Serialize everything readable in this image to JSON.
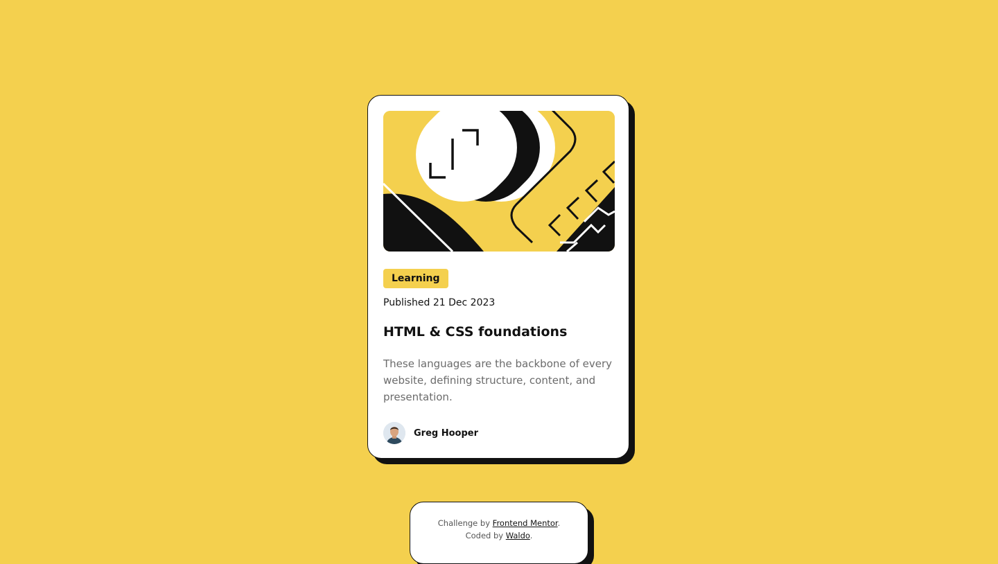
{
  "card": {
    "tag": "Learning",
    "published": "Published 21 Dec 2023",
    "title": "HTML & CSS foundations",
    "description": "These languages are the backbone of every website, defining structure, content, and presentation.",
    "author": "Greg Hooper",
    "hero_icon": "code-illustration"
  },
  "attribution": {
    "challenge_prefix": "Challenge by",
    "challenge_link": "Frontend Mentor",
    "coded_prefix": "Coded by",
    "coded_link": "Waldo",
    "period": "."
  },
  "colors": {
    "background": "#f4d04e",
    "card": "#ffffff",
    "ink": "#111111",
    "muted": "#6b6b6b"
  }
}
